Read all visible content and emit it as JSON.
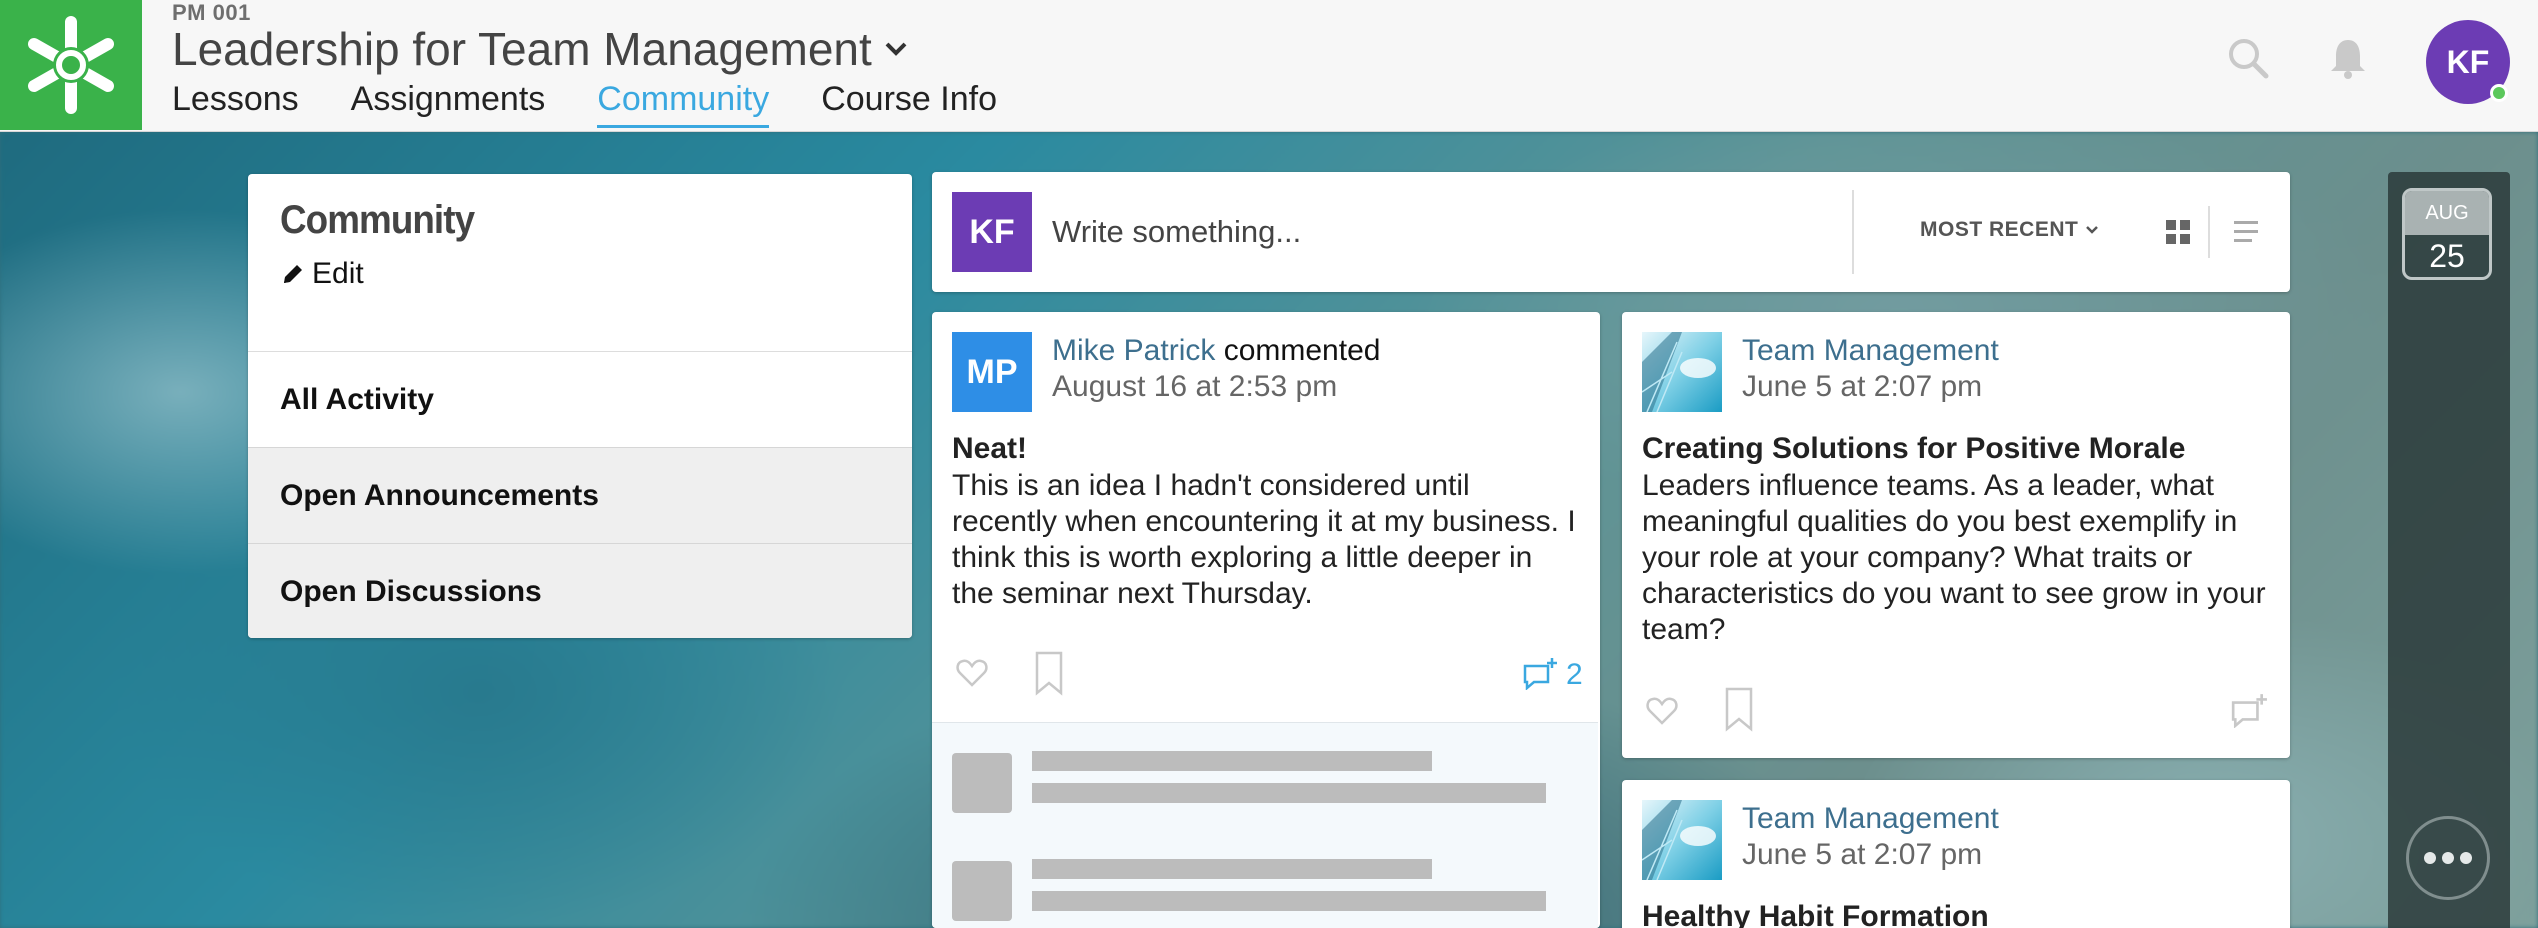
{
  "header": {
    "course_code": "PM 001",
    "course_title": "Leadership for Team Management",
    "tabs": [
      {
        "label": "Lessons",
        "active": false
      },
      {
        "label": "Assignments",
        "active": false
      },
      {
        "label": "Community",
        "active": true
      },
      {
        "label": "Course Info",
        "active": false
      }
    ],
    "user_initials": "KF"
  },
  "sidebar": {
    "title": "Community",
    "edit_label": "Edit",
    "items": [
      {
        "label": "All Activity"
      },
      {
        "label": "Open Announcements"
      },
      {
        "label": "Open Discussions"
      }
    ]
  },
  "composer": {
    "avatar_initials": "KF",
    "placeholder": "Write something...",
    "sort_label": "MOST RECENT"
  },
  "posts": [
    {
      "avatar_initials": "MP",
      "author": "Mike Patrick",
      "action": "commented",
      "date": "August 16 at 2:53 pm",
      "title": "Neat!",
      "body": "This is an idea I hadn't considered until recently when encountering it at my business. I think this is worth exploring a little deeper in the seminar next Thursday.",
      "comment_count": "2"
    },
    {
      "author": "Team Management",
      "date": "June 5 at 2:07 pm",
      "title": "Creating Solutions for Positive Morale",
      "body": "Leaders influence teams. As a leader, what meaningful qualities do you best exemplify in your role at your company? What traits or characteristics do you want to see grow in your team?"
    },
    {
      "author": "Team Management",
      "date": "June 5 at 2:07 pm",
      "title": "Healthy Habit Formation"
    }
  ],
  "calendar": {
    "month": "AUG",
    "day": "25"
  },
  "colors": {
    "brand_green": "#3ab24a",
    "accent_blue": "#3aa8e0",
    "user_purple": "#6c3cb4",
    "author_blue": "#3d6f8e",
    "mp_blue": "#2e8ee6"
  },
  "icons": [
    "app-logo-icon",
    "chevron-down-icon",
    "search-icon",
    "bell-icon",
    "pencil-icon",
    "grid-view-icon",
    "list-view-icon",
    "heart-icon",
    "bookmark-icon",
    "comment-icon",
    "more-icon"
  ]
}
